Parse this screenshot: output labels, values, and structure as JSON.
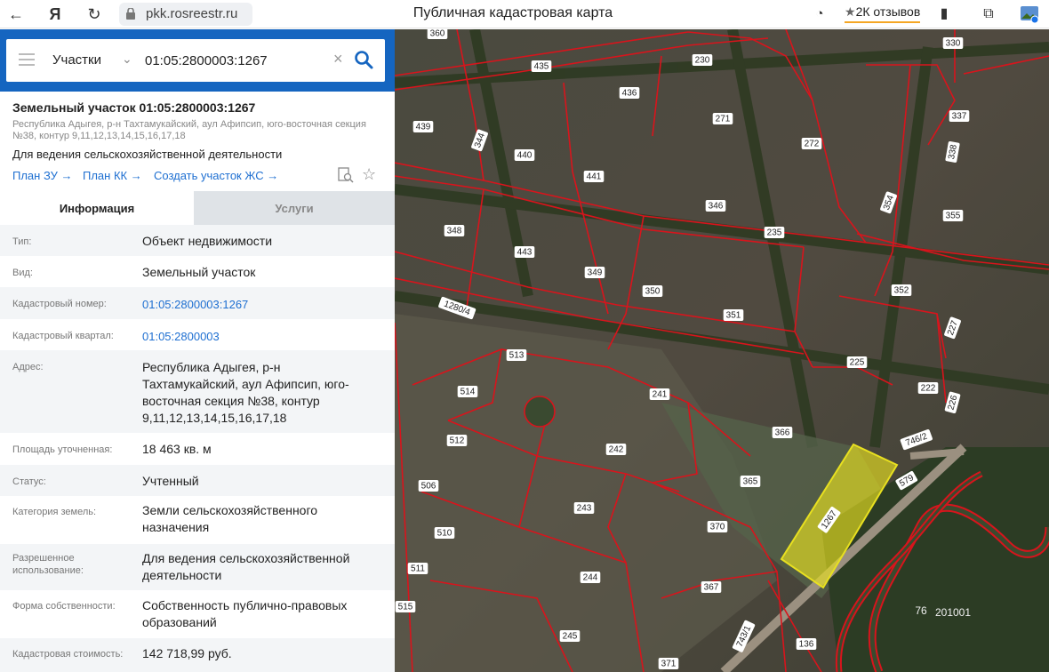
{
  "browser": {
    "url": "pkk.rosreestr.ru",
    "title": "Публичная кадастровая карта",
    "reviews": "2К отзывов"
  },
  "search": {
    "type": "Участки",
    "value": "01:05:2800003:1267"
  },
  "object": {
    "title": "Земельный участок 01:05:2800003:1267",
    "address_line": "Республика Адыгея, р-н Тахтамукайский, аул Афипсип, юго-восточная секция №38, контур 9,11,12,13,14,15,16,17,18",
    "use": "Для ведения сельскохозяйственной деятельности",
    "links": [
      "План ЗУ →",
      "План КК →",
      "Создать участок ЖС →"
    ]
  },
  "tabs": {
    "info": "Информация",
    "services": "Услуги"
  },
  "info": [
    {
      "label": "Тип:",
      "value": "Объект недвижимости"
    },
    {
      "label": "Вид:",
      "value": "Земельный участок"
    },
    {
      "label": "Кадастровый номер:",
      "value": "01:05:2800003:1267"
    },
    {
      "label": "Кадастровый квартал:",
      "value": "01:05:2800003"
    },
    {
      "label": "Адрес:",
      "value": "Республика Адыгея, р-н Тахтамукайский, аул Афипсип, юго-восточная секция №38, контур 9,11,12,13,14,15,16,17,18"
    },
    {
      "label": "Площадь уточненная:",
      "value": "18 463 кв. м"
    },
    {
      "label": "Статус:",
      "value": "Учтенный"
    },
    {
      "label": "Категория земель:",
      "value": "Земли сельскохозяйственного назначения"
    },
    {
      "label": "Разрешенное использование:",
      "value": "Для ведения сельскохозяйственной деятельности"
    },
    {
      "label": "Форма собственности:",
      "value": "Собственность публично-правовых образований"
    },
    {
      "label": "Кадастровая стоимость:",
      "value": "142 718,99 руб."
    }
  ],
  "map": {
    "labels": [
      "360",
      "435",
      "436",
      "230",
      "330",
      "439",
      "271",
      "337",
      "344",
      "440",
      "441",
      "272",
      "338",
      "346",
      "354",
      "348",
      "235",
      "355",
      "443",
      "349",
      "350",
      "351",
      "352",
      "1280/4",
      "227",
      "513",
      "225",
      "514",
      "241",
      "222",
      "226",
      "512",
      "242",
      "366",
      "746/2",
      "506",
      "365",
      "579",
      "243",
      "1267",
      "510",
      "370",
      "511",
      "244",
      "515",
      "367",
      "76",
      "201001",
      "245",
      "743/1",
      "136",
      "371"
    ],
    "highlight": "#e8e020",
    "boundary": "#d8141c"
  }
}
